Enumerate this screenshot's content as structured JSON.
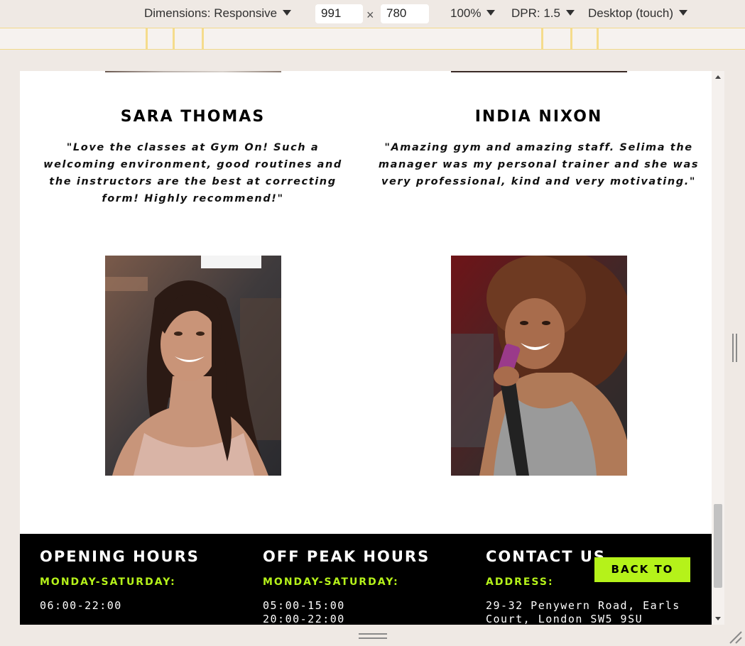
{
  "devtools": {
    "dimensions_label": "Dimensions: Responsive",
    "width_value": "991",
    "times": "×",
    "height_value": "780",
    "zoom": "100%",
    "dpr": "DPR: 1.5",
    "device_mode": "Desktop (touch)"
  },
  "testimonials": [
    {
      "name": "SARA THOMAS",
      "quote": "\"Love the classes at Gym On! Such a welcoming environment, good routines and the instructors are the best at correcting form! Highly recommend!\""
    },
    {
      "name": "INDIA NIXON",
      "quote": "\"Amazing gym and amazing staff. Selima the manager was my personal trainer and she was very professional, kind and very motivating.\""
    }
  ],
  "footer": {
    "opening": {
      "title": "OPENING HOURS",
      "subtitle": "MONDAY-SATURDAY:",
      "lines": [
        "06:00-22:00"
      ]
    },
    "offpeak": {
      "title": "OFF PEAK HOURS",
      "subtitle": "MONDAY-SATURDAY:",
      "lines": [
        "05:00-15:00",
        "20:00-22:00"
      ]
    },
    "contact": {
      "title": "CONTACT US",
      "subtitle": "ADDRESS:",
      "lines": [
        "29-32 Penywern Road, Earls",
        "Court, London SW5 9SU"
      ]
    },
    "back_to_top": "BACK TO TOP"
  },
  "colors": {
    "accent": "#b5f21a",
    "footer_bg": "#000000",
    "devbar_bg": "#efe9e4"
  }
}
